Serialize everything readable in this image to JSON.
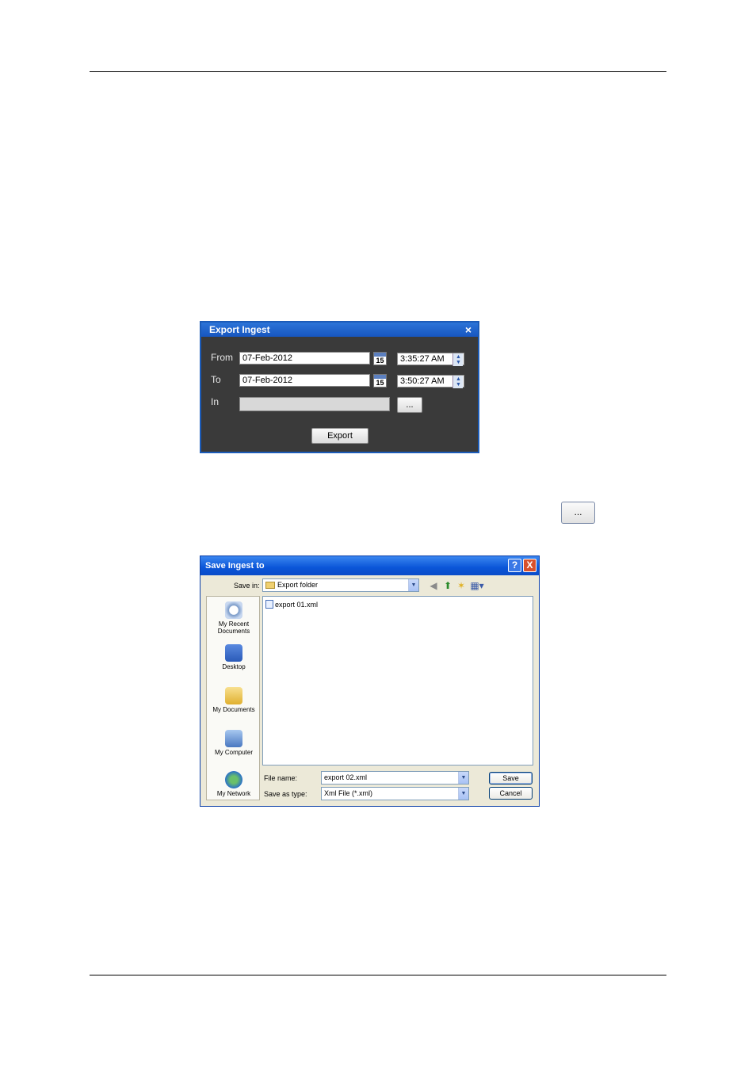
{
  "export_dialog": {
    "title": "Export Ingest",
    "close": "×",
    "from_label": "From",
    "from_date": "07-Feb-2012",
    "from_time": "3:35:27 AM",
    "to_label": "To",
    "to_date": "07-Feb-2012",
    "to_time": "3:50:27 AM",
    "in_label": "In",
    "in_value": "",
    "browse_label": "...",
    "calendar_day": "15",
    "export_label": "Export"
  },
  "browse_button_label": "...",
  "save_dialog": {
    "title": "Save Ingest to",
    "help": "?",
    "close": "X",
    "save_in_label": "Save in:",
    "save_in_value": "Export folder",
    "places": [
      {
        "label": "My Recent Documents",
        "icon": "recent-documents-icon"
      },
      {
        "label": "Desktop",
        "icon": "desktop-icon"
      },
      {
        "label": "My Documents",
        "icon": "my-documents-icon"
      },
      {
        "label": "My Computer",
        "icon": "my-computer-icon"
      },
      {
        "label": "My Network",
        "icon": "my-network-icon"
      }
    ],
    "files": [
      "export 01.xml"
    ],
    "file_name_label": "File name:",
    "file_name_value": "export 02.xml",
    "save_type_label": "Save as type:",
    "save_type_value": "Xml File (*.xml)",
    "save_button": "Save",
    "cancel_button": "Cancel"
  }
}
